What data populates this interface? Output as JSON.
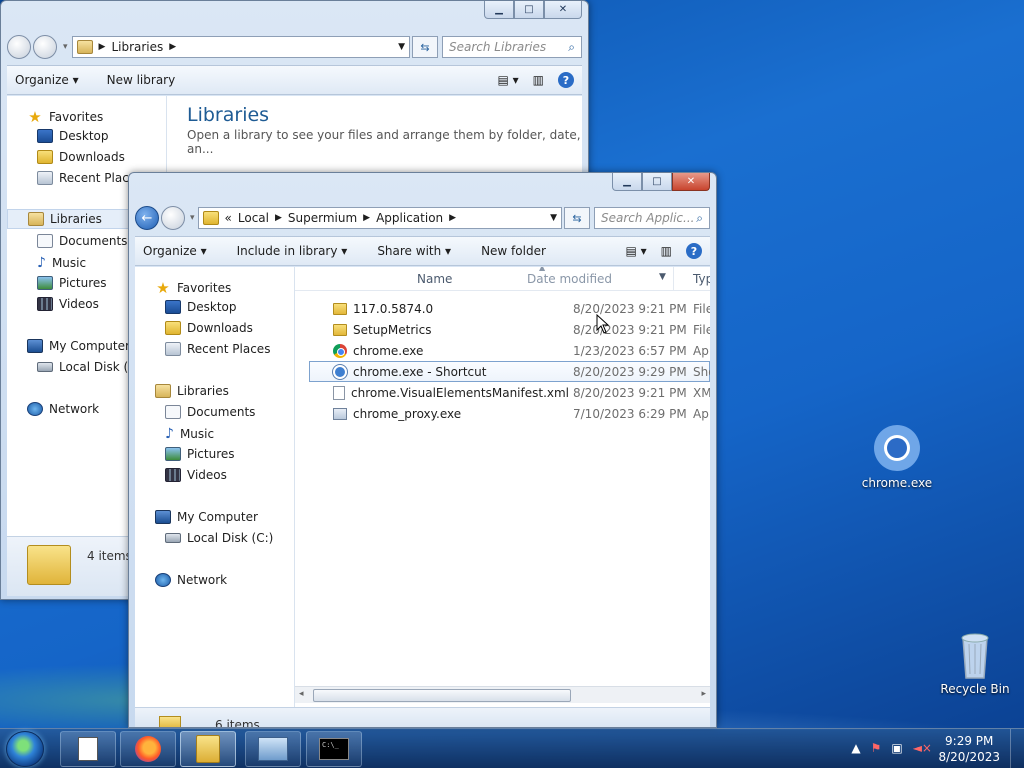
{
  "desktop": {
    "icons": [
      {
        "label": "chrome.exe",
        "icon": "chromium-icon"
      },
      {
        "label": "Recycle Bin",
        "icon": "recycle-bin-icon"
      }
    ]
  },
  "back_window": {
    "address": [
      "Libraries"
    ],
    "search_placeholder": "Search Libraries",
    "toolbar": {
      "organize": "Organize",
      "new_library": "New library"
    },
    "nav": {
      "favorites": "Favorites",
      "desktop": "Desktop",
      "downloads": "Downloads",
      "recent_places": "Recent Places",
      "libraries": "Libraries",
      "documents": "Documents",
      "music": "Music",
      "pictures": "Pictures",
      "videos": "Videos",
      "my_computer": "My Computer",
      "local_disk": "Local Disk (C:)",
      "network": "Network"
    },
    "heading": "Libraries",
    "subheading": "Open a library to see your files and arrange them by folder, date, an...",
    "status": "4 items"
  },
  "front_window": {
    "address": {
      "overflow": "«",
      "crumbs": [
        "Local",
        "Supermium",
        "Application"
      ]
    },
    "search_placeholder": "Search Applic...",
    "toolbar": {
      "organize": "Organize",
      "include_in_library": "Include in library",
      "share_with": "Share with",
      "new_folder": "New folder"
    },
    "nav": {
      "favorites": "Favorites",
      "desktop": "Desktop",
      "downloads": "Downloads",
      "recent_places": "Recent Places",
      "libraries": "Libraries",
      "documents": "Documents",
      "music": "Music",
      "pictures": "Pictures",
      "videos": "Videos",
      "my_computer": "My Computer",
      "local_disk": "Local Disk (C:)",
      "network": "Network"
    },
    "columns": {
      "name": "Name",
      "date_modified": "Date modified",
      "type": "Typ"
    },
    "files": [
      {
        "name": "117.0.5874.0",
        "date": "8/20/2023 9:21 PM",
        "type": "File",
        "icon": "folder-icon"
      },
      {
        "name": "SetupMetrics",
        "date": "8/20/2023 9:21 PM",
        "type": "File",
        "icon": "folder-icon"
      },
      {
        "name": "chrome.exe",
        "date": "1/23/2023 6:57 PM",
        "type": "Ap",
        "icon": "chrome-icon"
      },
      {
        "name": "chrome.exe - Shortcut",
        "date": "8/20/2023 9:29 PM",
        "type": "Sho",
        "icon": "shortcut-icon"
      },
      {
        "name": "chrome.VisualElementsManifest.xml",
        "date": "8/20/2023 9:21 PM",
        "type": "XM",
        "icon": "xml-file-icon"
      },
      {
        "name": "chrome_proxy.exe",
        "date": "7/10/2023 6:29 PM",
        "type": "Ap",
        "icon": "exe-icon"
      }
    ],
    "status": "6 items"
  },
  "taskbar": {
    "buttons": [
      "notepad-icon",
      "firefox-icon",
      "explorer-icon",
      "control-panel-icon",
      "cmd-icon"
    ],
    "cmd_text": "C:\\_",
    "time": "9:29 PM",
    "date": "8/20/2023"
  }
}
